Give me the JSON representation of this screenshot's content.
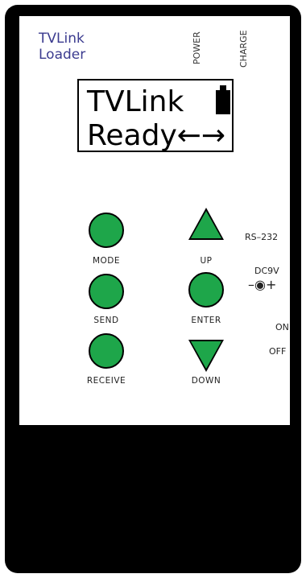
{
  "brand": {
    "line1": "TVLink",
    "line2": "Loader"
  },
  "indicators": {
    "power": "POWER",
    "charge": "CHARGE"
  },
  "lcd": {
    "line1": "TVLink",
    "line2": "Ready←→",
    "battery_icon": "battery-icon"
  },
  "buttons": {
    "mode": "MODE",
    "send": "SEND",
    "receive": "RECEIVE",
    "up": "UP",
    "enter": "ENTER",
    "down": "DOWN"
  },
  "side": {
    "rs232": "RS–232",
    "dc": "DC9V",
    "dc_symbol": "–◉+",
    "on": "ON",
    "off": "OFF"
  },
  "colors": {
    "button_green": "#1ea64a",
    "brand_blue": "#3b3b8f",
    "device_body": "#000000"
  }
}
